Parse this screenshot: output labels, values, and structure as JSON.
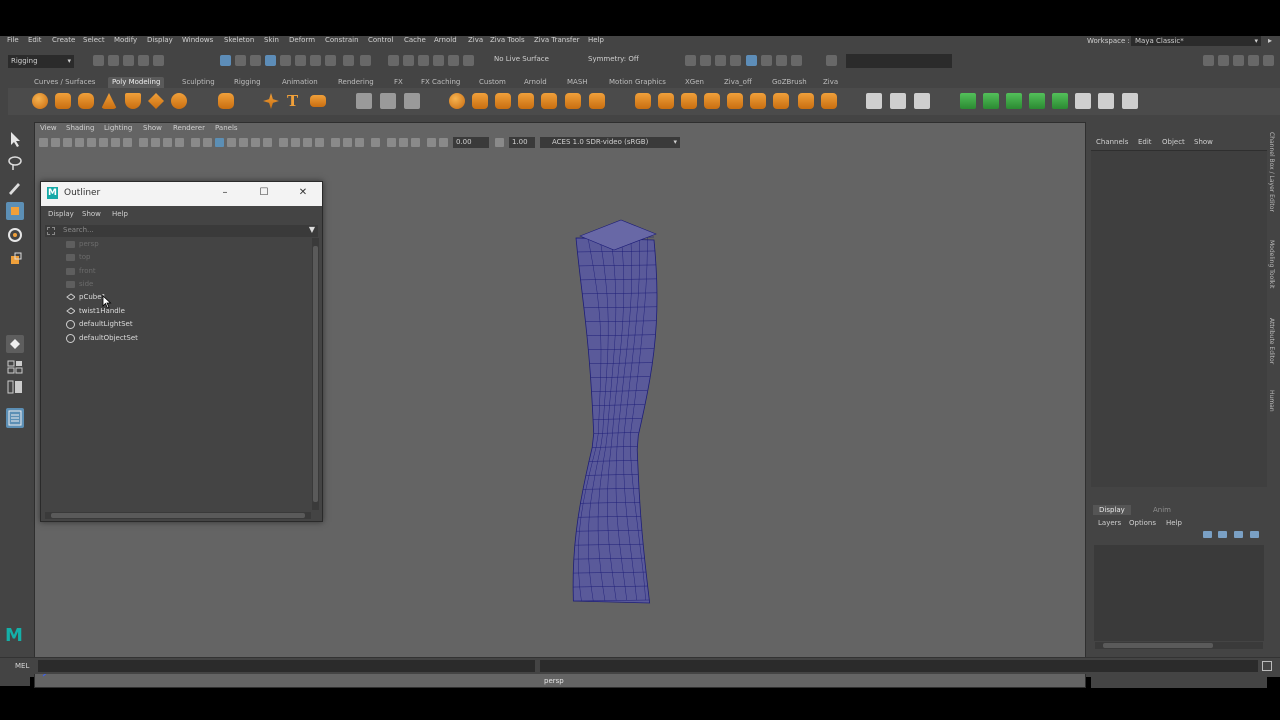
{
  "menubar": {
    "items": [
      "File",
      "Edit",
      "Create",
      "Select",
      "Modify",
      "Display",
      "Windows",
      "Skeleton",
      "Skin",
      "Deform",
      "Constrain",
      "Control",
      "Cache",
      "Arnold",
      "Ziva",
      "Ziva Tools",
      "Ziva Transfer",
      "Help"
    ],
    "workspace_label": "Workspace :",
    "workspace_value": "Maya Classic*"
  },
  "statusline": {
    "mode": "Rigging",
    "live_surface": "No Live Surface",
    "symmetry": "Symmetry: Off"
  },
  "shelf": {
    "tabs": [
      "Curves / Surfaces",
      "Poly Modeling",
      "Sculpting",
      "Rigging",
      "Animation",
      "Rendering",
      "FX",
      "FX Caching",
      "Custom",
      "Arnold",
      "MASH",
      "Motion Graphics",
      "XGen",
      "Ziva_off",
      "GoZBrush",
      "Ziva"
    ],
    "active_tab": "Poly Modeling"
  },
  "viewport": {
    "menu": [
      "View",
      "Shading",
      "Lighting",
      "Show",
      "Renderer",
      "Panels"
    ],
    "exposure": "0.00",
    "gamma": "1.00",
    "colorspace": "ACES 1.0 SDR-video (sRGB)",
    "camera": "persp",
    "mesh_color": "#5a5a9a",
    "wire_color": "#1e1e78"
  },
  "outliner": {
    "title": "Outliner",
    "menu": [
      "Display",
      "Show",
      "Help"
    ],
    "search_placeholder": "Search...",
    "items": [
      {
        "label": "persp",
        "icon": "camera-icon",
        "dim": true
      },
      {
        "label": "top",
        "icon": "camera-icon",
        "dim": true
      },
      {
        "label": "front",
        "icon": "camera-icon",
        "dim": true
      },
      {
        "label": "side",
        "icon": "camera-icon",
        "dim": true
      },
      {
        "label": "pCube1",
        "icon": "transform-icon",
        "dim": false
      },
      {
        "label": "twist1Handle",
        "icon": "transform-icon",
        "dim": false
      },
      {
        "label": "defaultLightSet",
        "icon": "set-icon",
        "dim": false
      },
      {
        "label": "defaultObjectSet",
        "icon": "set-icon",
        "dim": false
      }
    ]
  },
  "channelbox": {
    "menu": [
      "Channels",
      "Edit",
      "Object",
      "Show"
    ]
  },
  "layers": {
    "tabs": [
      "Display",
      "Anim"
    ],
    "menu": [
      "Layers",
      "Options",
      "Help"
    ]
  },
  "side_tabs": [
    "Channel Box / Layer Editor",
    "Modeling Toolkit",
    "Attribute Editor",
    "Human"
  ],
  "cmdline": {
    "label": "MEL"
  },
  "logo": "M"
}
